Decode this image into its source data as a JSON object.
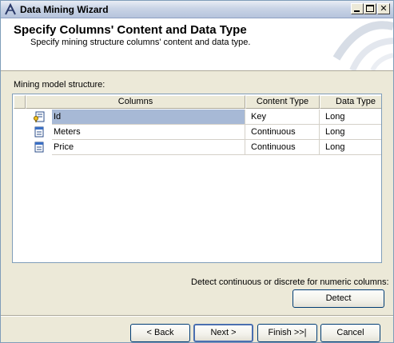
{
  "window": {
    "title": "Data Mining Wizard"
  },
  "header": {
    "title": "Specify Columns' Content and Data Type",
    "subtitle": "Specify mining structure columns' content and data type."
  },
  "structure": {
    "label": "Mining model structure:",
    "columns": [
      "Columns",
      "Content Type",
      "Data Type"
    ],
    "rows": [
      {
        "name": "Id",
        "content_type": "Key",
        "data_type": "Long",
        "icon": "key-column-icon",
        "selected": true
      },
      {
        "name": "Meters",
        "content_type": "Continuous",
        "data_type": "Long",
        "icon": "column-icon",
        "selected": false
      },
      {
        "name": "Price",
        "content_type": "Continuous",
        "data_type": "Long",
        "icon": "column-icon",
        "selected": false
      }
    ]
  },
  "detect": {
    "label": "Detect continuous or discrete for numeric columns:",
    "button": "Detect"
  },
  "footer": {
    "back": "< Back",
    "next": "Next >",
    "finish": "Finish >>|",
    "cancel": "Cancel"
  },
  "colors": {
    "selection": "#a7b9d6",
    "title_bar": "#c9d4e6",
    "dialog_bg": "#ece9d8"
  }
}
